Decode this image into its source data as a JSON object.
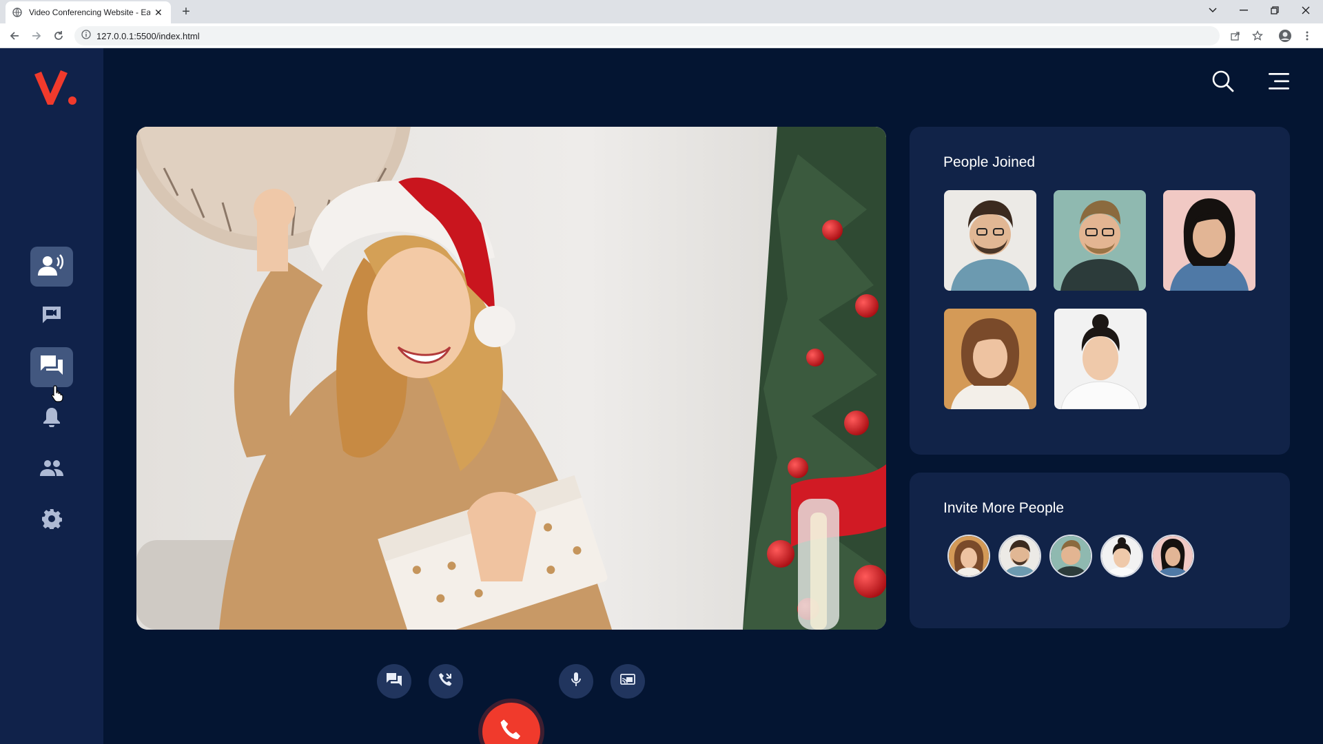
{
  "browser": {
    "tab_title": "Video Conferencing Website - Ea",
    "url": "127.0.0.1:5500/index.html"
  },
  "colors": {
    "background": "#041532",
    "sidebar": "#10224a",
    "panel": "#112348",
    "accent": "#f03a2c",
    "active_item": "#42577f"
  },
  "sidebar": {
    "logo": "V.",
    "items": [
      {
        "name": "speaker-icon",
        "active": true
      },
      {
        "name": "video-chat-icon",
        "active": false
      },
      {
        "name": "chat-icon",
        "active": true
      },
      {
        "name": "bell-icon",
        "active": false
      },
      {
        "name": "people-icon",
        "active": false
      },
      {
        "name": "gear-icon",
        "active": false
      }
    ]
  },
  "header": {
    "search_icon": "search-icon",
    "menu_icon": "menu-icon"
  },
  "main_video": {
    "description_icon": "video-feed"
  },
  "people_joined": {
    "title": "People Joined",
    "count": 5
  },
  "invite_more": {
    "title": "Invite More People",
    "count": 5
  },
  "controls": [
    {
      "name": "chat-button-icon"
    },
    {
      "name": "call-transfer-icon"
    },
    {
      "name": "end-call-icon"
    },
    {
      "name": "microphone-icon"
    },
    {
      "name": "screen-share-icon"
    }
  ]
}
